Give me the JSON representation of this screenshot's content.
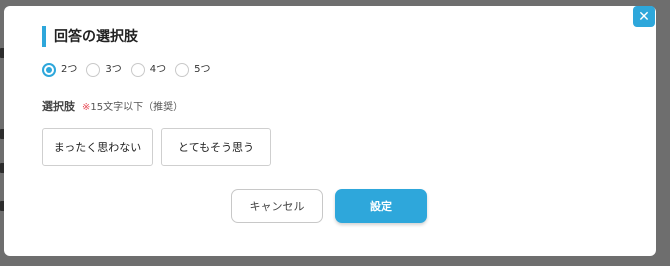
{
  "dialog": {
    "title": "回答の選択肢",
    "close_icon": "close-icon",
    "accent_color": "#2ea7db"
  },
  "options_count": {
    "selected": "2つ",
    "items": [
      {
        "label": "2つ",
        "selected": true
      },
      {
        "label": "3つ",
        "selected": false
      },
      {
        "label": "4つ",
        "selected": false
      },
      {
        "label": "5つ",
        "selected": false
      }
    ]
  },
  "choices": {
    "label": "選択肢",
    "note_mark": "※",
    "note_text": "15文字以下（推奨）",
    "note_color": "#e8505b",
    "items": [
      {
        "value": "まったく思わない"
      },
      {
        "value": "とてもそう思う"
      }
    ]
  },
  "actions": {
    "cancel_label": "キャンセル",
    "save_label": "設定"
  }
}
